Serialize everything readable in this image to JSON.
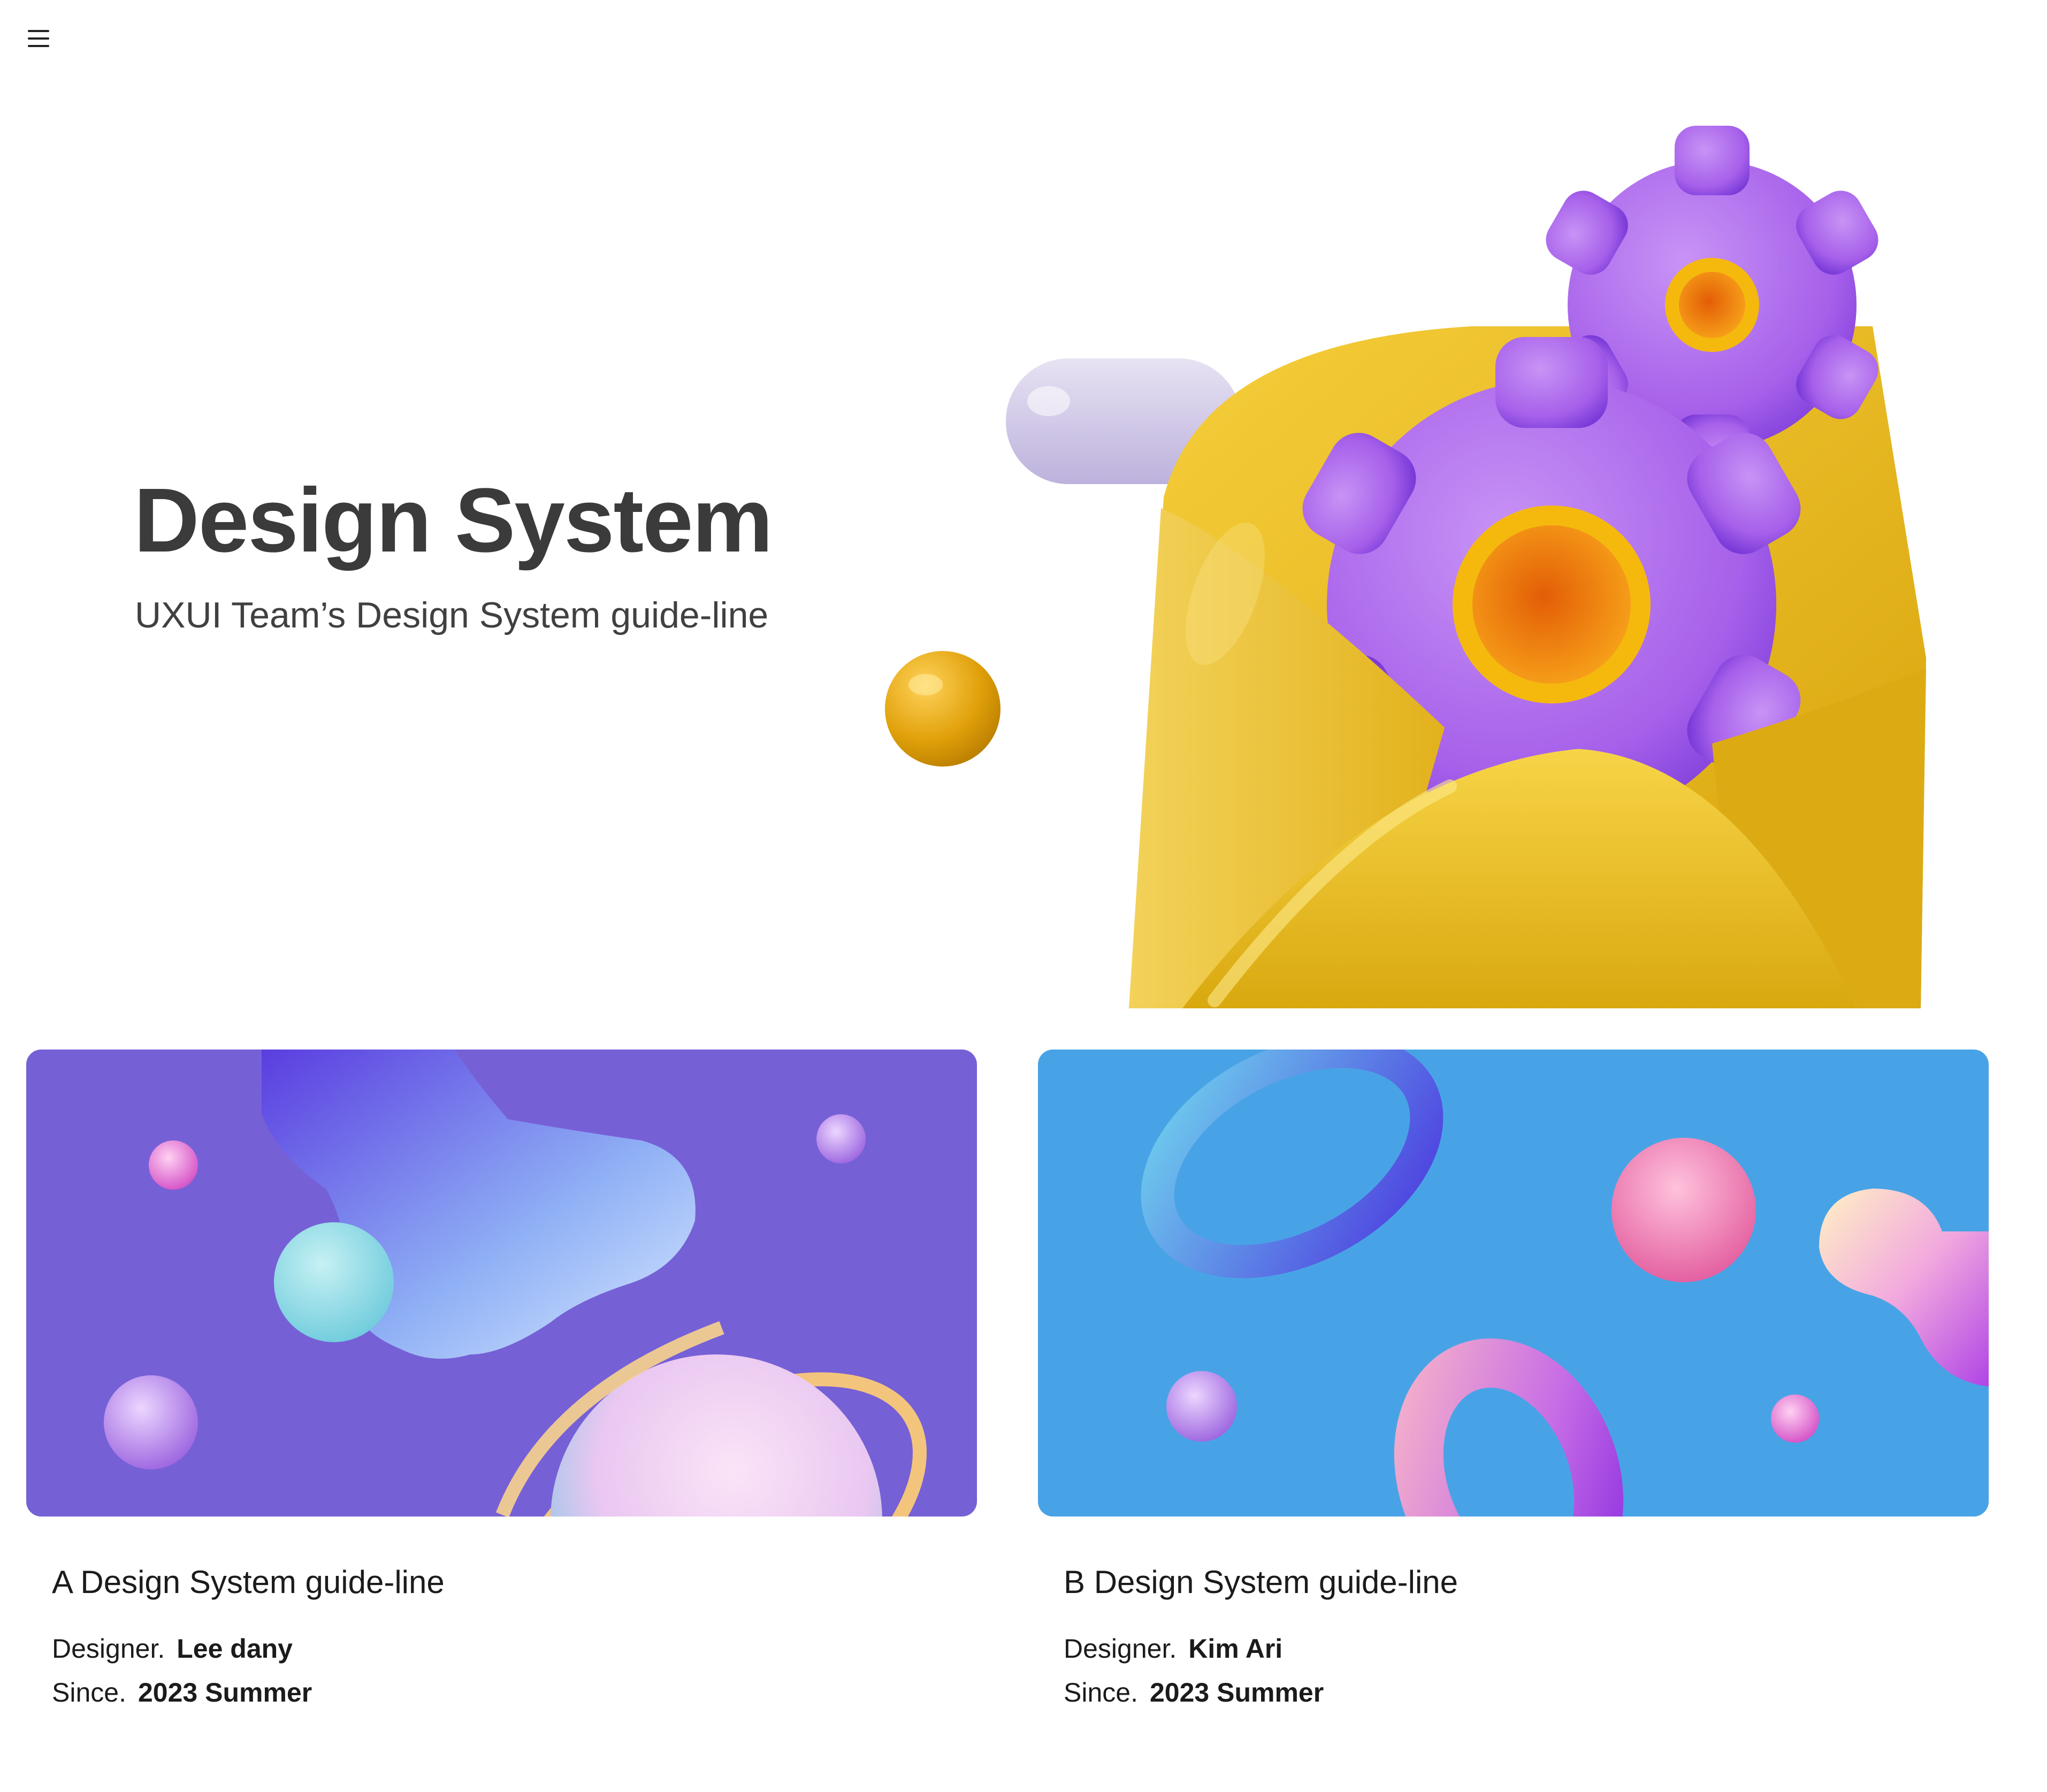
{
  "header": {
    "menu_icon": "hamburger-menu-icon"
  },
  "hero": {
    "title": "Design System",
    "subtitle": "UXUI Team’s Design System guide-line",
    "illustration": "envelope-with-gears-3d-illustration"
  },
  "cards": [
    {
      "title": "A Design System guide-line",
      "designer_label": "Designer.",
      "designer_name": "Lee dany",
      "since_label": "Since.",
      "since_value": "2023 Summer",
      "image": "purple-3d-planet-blob-illustration",
      "background_color": "#7660d6"
    },
    {
      "title": "B Design System guide-line",
      "designer_label": "Designer.",
      "designer_name": "Kim Ari",
      "since_label": "Since.",
      "since_value": "2023 Summer",
      "image": "blue-3d-rings-spheres-illustration",
      "background_color": "#48a3e6"
    }
  ],
  "colors": {
    "background": "#ffffff",
    "title_text": "#3b3b3b",
    "body_text": "#1b1b1b",
    "envelope_yellow": "#e8b81a",
    "gear_purple": "#a862ea"
  }
}
